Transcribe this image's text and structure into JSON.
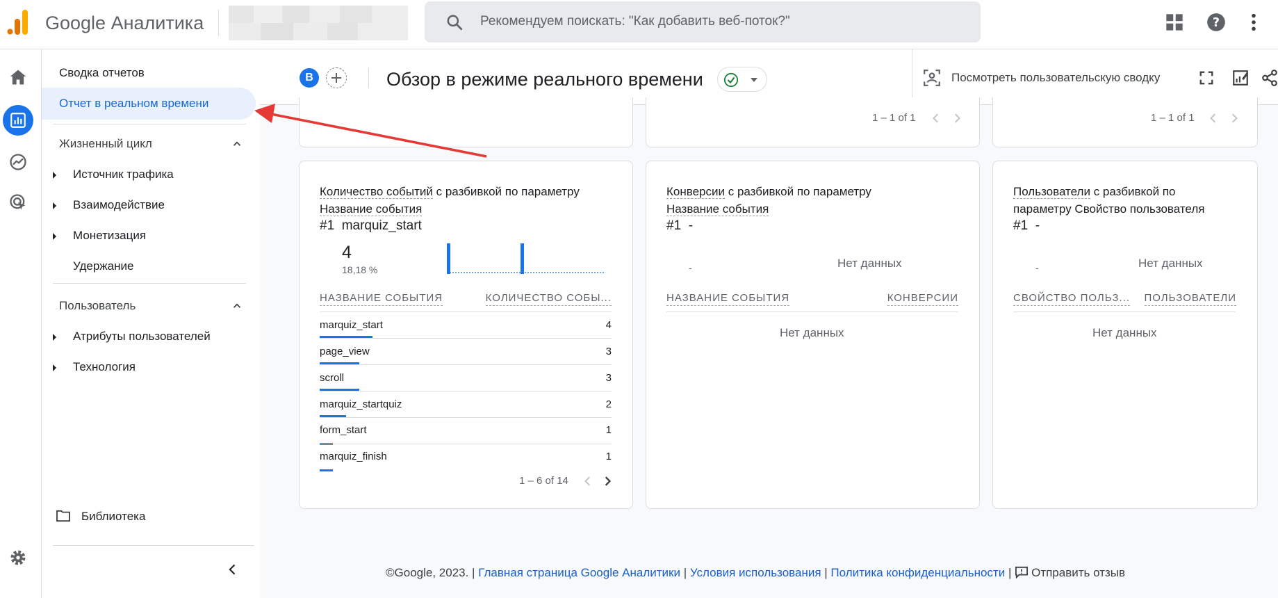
{
  "topbar": {
    "brand": "Google Аналитика",
    "search_placeholder": "Рекомендуем поискать: \"Как добавить веб-поток?\""
  },
  "nav": {
    "reports_snapshot": "Сводка отчетов",
    "realtime": "Отчет в реальном времени",
    "lifecycle": "Жизненный цикл",
    "lifecycle_items": [
      "Источник трафика",
      "Взаимодействие",
      "Монетизация",
      "Удержание"
    ],
    "user": "Пользователь",
    "user_items": [
      "Атрибуты пользователей",
      "Технология"
    ],
    "library": "Библиотека"
  },
  "header": {
    "avatar_letter": "B",
    "title": "Обзор в режиме реального времени",
    "view_user_snapshot": "Посмотреть пользовательскую сводку"
  },
  "top_cards": {
    "pager_1": "1 – 1 of 1",
    "pager_2": "1 – 1 of 1"
  },
  "card_events": {
    "title_part1": "Количество событий",
    "title_part2": " с разбивкой по параметру",
    "title_part3": "Название события",
    "rank": "#1",
    "rank_value": "marquiz_start",
    "big_number": "4",
    "percent": "18,18 %",
    "col1": "НАЗВАНИЕ СОБЫТИЯ",
    "col2": "КОЛИЧЕСТВО СОБЫ...",
    "rows": [
      {
        "name": "marquiz_start",
        "value": "4",
        "share": 1.0
      },
      {
        "name": "page_view",
        "value": "3",
        "share": 0.75
      },
      {
        "name": "scroll",
        "value": "3",
        "share": 0.75
      },
      {
        "name": "marquiz_startquiz",
        "value": "2",
        "share": 0.5
      },
      {
        "name": "form_start",
        "value": "1",
        "share": 0.25
      },
      {
        "name": "marquiz_finish",
        "value": "1",
        "share": 0.25
      }
    ],
    "pager": "1 – 6 of 14"
  },
  "card_conversions": {
    "title_part1": "Конверсии",
    "title_part2": " с разбивкой по параметру",
    "title_part3": "Название события",
    "rank": "#1",
    "rank_value": "-",
    "sparkline_placeholder": "-",
    "no_data_chart": "Нет данных",
    "col1": "НАЗВАНИЕ СОБЫТИЯ",
    "col2": "КОНВЕРСИИ",
    "no_data_table": "Нет данных"
  },
  "card_users": {
    "title_part1": "Пользователи",
    "title_part2": " с разбивкой по",
    "title_part3": "параметру Свойство пользователя",
    "rank": "#1",
    "rank_value": "-",
    "sparkline_placeholder": "-",
    "no_data_chart": "Нет данных",
    "col1": "СВОЙСТВО ПОЛЬЗ...",
    "col2": "ПОЛЬЗОВАТЕЛИ",
    "no_data_table": "Нет данных"
  },
  "footer": {
    "copyright": "©Google, 2023. | ",
    "link_home": "Главная страница Google Аналитики",
    "sep1": " | ",
    "link_terms": "Условия использования",
    "sep2": " | ",
    "link_privacy": "Политика конфиденциальности",
    "sep3": " | ",
    "feedback": "Отправить отзыв"
  },
  "colors": {
    "accent": "#1a73e8",
    "annotation_arrow": "#e53935",
    "active_nav_bg": "#e8f0fe"
  }
}
